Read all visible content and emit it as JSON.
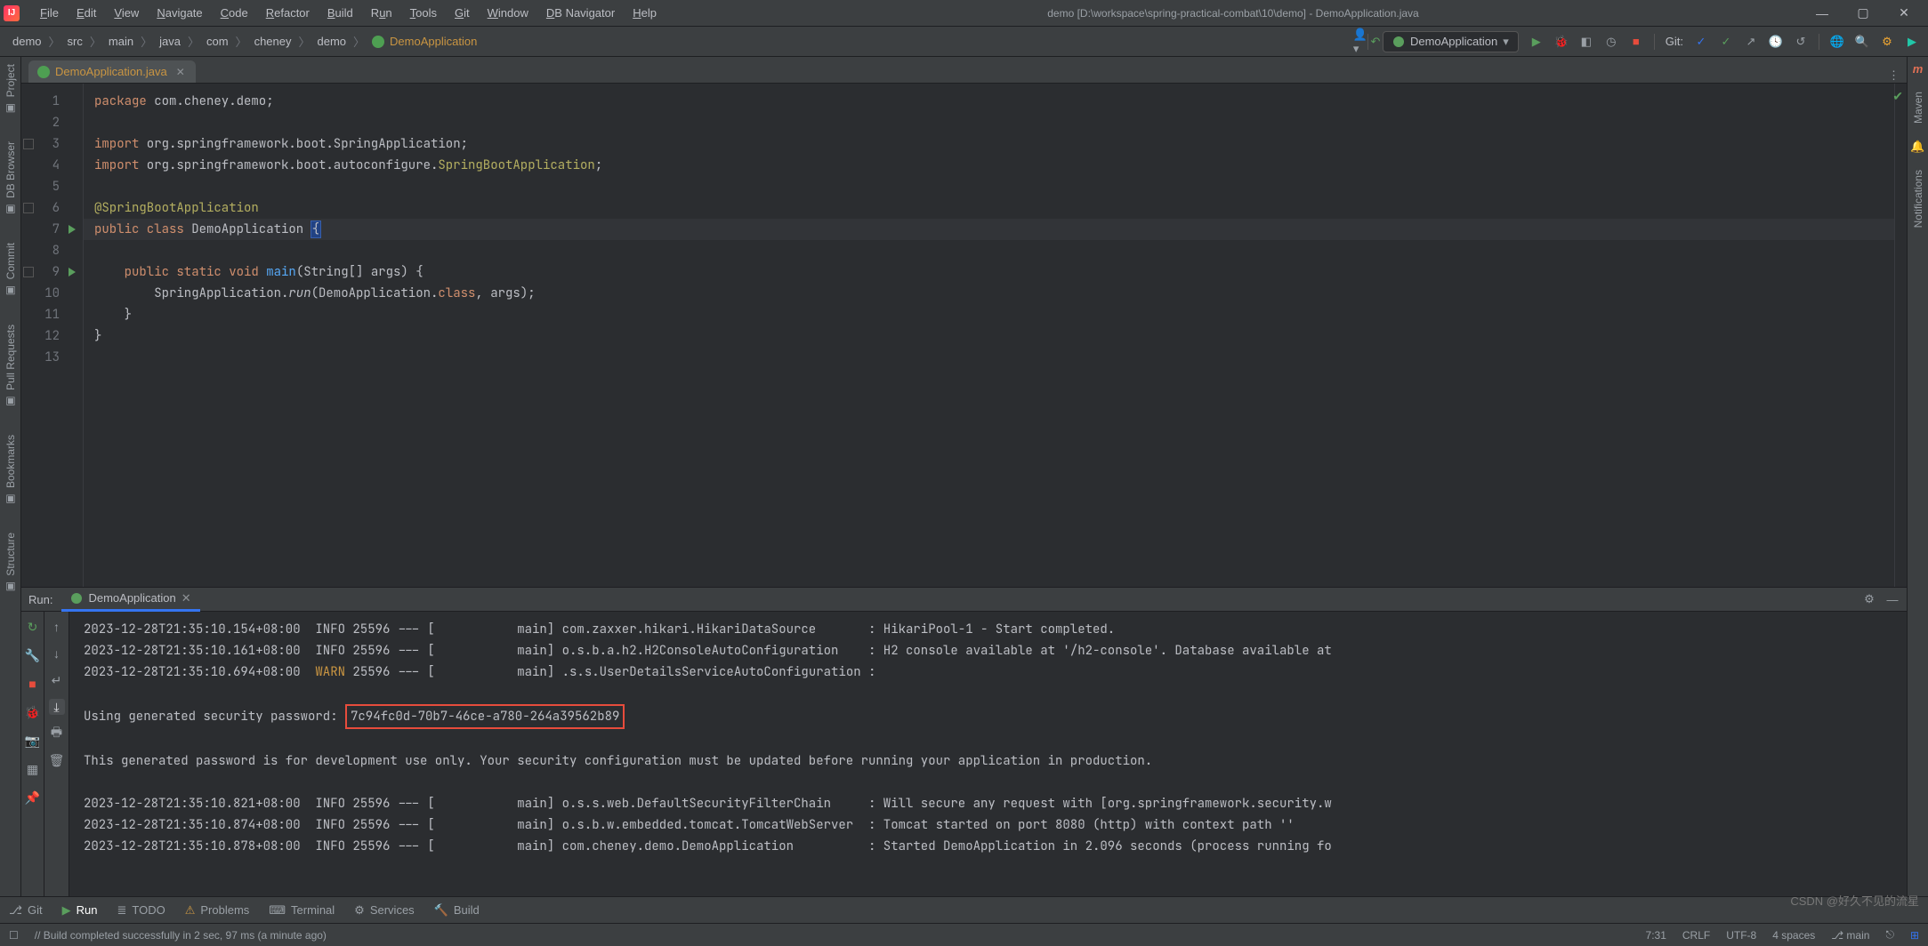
{
  "title": "demo [D:\\workspace\\spring-practical-combat\\10\\demo] - DemoApplication.java",
  "menu": [
    {
      "label": "File",
      "u": "F"
    },
    {
      "label": "Edit",
      "u": "E"
    },
    {
      "label": "View",
      "u": "V"
    },
    {
      "label": "Navigate",
      "u": "N"
    },
    {
      "label": "Code",
      "u": "C"
    },
    {
      "label": "Refactor",
      "u": "R"
    },
    {
      "label": "Build",
      "u": "B"
    },
    {
      "label": "Run",
      "u": "u"
    },
    {
      "label": "Tools",
      "u": "T"
    },
    {
      "label": "Git",
      "u": "G"
    },
    {
      "label": "Window",
      "u": "W"
    },
    {
      "label": "DB Navigator",
      "u": "D"
    },
    {
      "label": "Help",
      "u": "H"
    }
  ],
  "breadcrumbs": [
    "demo",
    "src",
    "main",
    "java",
    "com",
    "cheney",
    "demo",
    "DemoApplication"
  ],
  "run_config": "DemoApplication",
  "git_label": "Git:",
  "tab": {
    "label": "DemoApplication.java"
  },
  "left_tools": [
    "Project",
    "DB Browser",
    "Commit",
    "Pull Requests",
    "Bookmarks",
    "Structure"
  ],
  "right_tools": [
    "Maven",
    "Notifications"
  ],
  "code": {
    "lines": [
      {
        "n": "1",
        "fold": false,
        "tri": false,
        "html": "<span class='k'>package</span> com.cheney.demo<span class='p'>;</span>"
      },
      {
        "n": "2",
        "html": ""
      },
      {
        "n": "3",
        "fold": true,
        "html": "<span class='k'>import</span> org.springframework.boot.SpringApplication<span class='p'>;</span>"
      },
      {
        "n": "4",
        "html": "<span class='k'>import</span> org.springframework.boot.autoconfigure.<span class='a'>SpringBootApplication</span><span class='p'>;</span>"
      },
      {
        "n": "5",
        "html": ""
      },
      {
        "n": "6",
        "fold": true,
        "html": "<span class='a'>@SpringBootApplication</span>"
      },
      {
        "n": "7",
        "tri": true,
        "html": "<span class='k'>public class</span> DemoApplication <span class='caret'>{</span>"
      },
      {
        "n": "8",
        "html": ""
      },
      {
        "n": "9",
        "fold": true,
        "tri": true,
        "html": "    <span class='k'>public static void</span> <span class='c'>main</span>(String[] args) <span class='br'>{</span>"
      },
      {
        "n": "10",
        "html": "        SpringApplication.<span class='m'>run</span>(DemoApplication.<span class='k'>class</span>, args);"
      },
      {
        "n": "11",
        "html": "    <span class='br'>}</span>"
      },
      {
        "n": "12",
        "html": "<span class='br'>}</span>"
      },
      {
        "n": "13",
        "html": ""
      }
    ]
  },
  "tool": {
    "title": "Run:",
    "tab": "DemoApplication",
    "console_lines": [
      "2023-12-28T21:35:10.154+08:00  INFO 25596 --- [           main] com.zaxxer.hikari.HikariDataSource       : HikariPool-1 - Start completed.",
      "2023-12-28T21:35:10.161+08:00  INFO 25596 --- [           main] o.s.b.a.h2.H2ConsoleAutoConfiguration    : H2 console available at '/h2-console'. Database available at",
      "2023-12-28T21:35:10.694+08:00  WARN 25596 --- [           main] .s.s.UserDetailsServiceAutoConfiguration :"
    ],
    "pw_prefix": "Using generated security password: ",
    "pw_value": "7c94fc0d-70b7-46ce-a780-264a39562b89",
    "pw_note": "This generated password is for development use only. Your security configuration must be updated before running your application in production.",
    "console_tail": [
      "2023-12-28T21:35:10.821+08:00  INFO 25596 --- [           main] o.s.s.web.DefaultSecurityFilterChain     : Will secure any request with [org.springframework.security.w",
      "2023-12-28T21:35:10.874+08:00  INFO 25596 --- [           main] o.s.b.w.embedded.tomcat.TomcatWebServer  : Tomcat started on port 8080 (http) with context path ''",
      "2023-12-28T21:35:10.878+08:00  INFO 25596 --- [           main] com.cheney.demo.DemoApplication          : Started DemoApplication in 2.096 seconds (process running fo"
    ]
  },
  "bottom_tabs": [
    {
      "icon": "branch",
      "label": "Git"
    },
    {
      "icon": "play",
      "label": "Run",
      "active": true
    },
    {
      "icon": "list",
      "label": "TODO"
    },
    {
      "icon": "warn",
      "label": "Problems"
    },
    {
      "icon": "term",
      "label": "Terminal"
    },
    {
      "icon": "gear",
      "label": "Services"
    },
    {
      "icon": "hammer",
      "label": "Build"
    }
  ],
  "status": {
    "msg": "// Build completed successfully in 2 sec, 97 ms (a minute ago)",
    "pos": "7:31",
    "eol": "CRLF",
    "enc": "UTF-8",
    "indent": "4 spaces",
    "branch": "main",
    "lock": "⎋"
  },
  "watermark": "CSDN @好久不见的流星"
}
